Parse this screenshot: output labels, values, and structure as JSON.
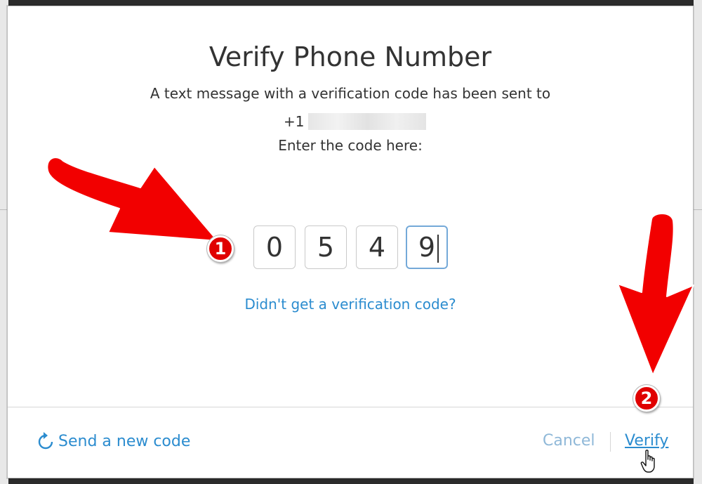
{
  "dialog": {
    "title": "Verify Phone Number",
    "message": "A text message with a verification code has been sent to",
    "phone_prefix": "+1",
    "instruction": "Enter the code here:",
    "code_digits": [
      "0",
      "5",
      "4",
      "9"
    ],
    "help_link": "Didn't get a verification code?"
  },
  "footer": {
    "send_new_code_label": "Send a new code",
    "cancel_label": "Cancel",
    "verify_label": "Verify"
  },
  "annotations": {
    "badge_1": "1",
    "badge_2": "2"
  },
  "colors": {
    "link": "#2b8ccf",
    "annotation_red": "#e00000",
    "focused_border": "#74a9d8"
  }
}
